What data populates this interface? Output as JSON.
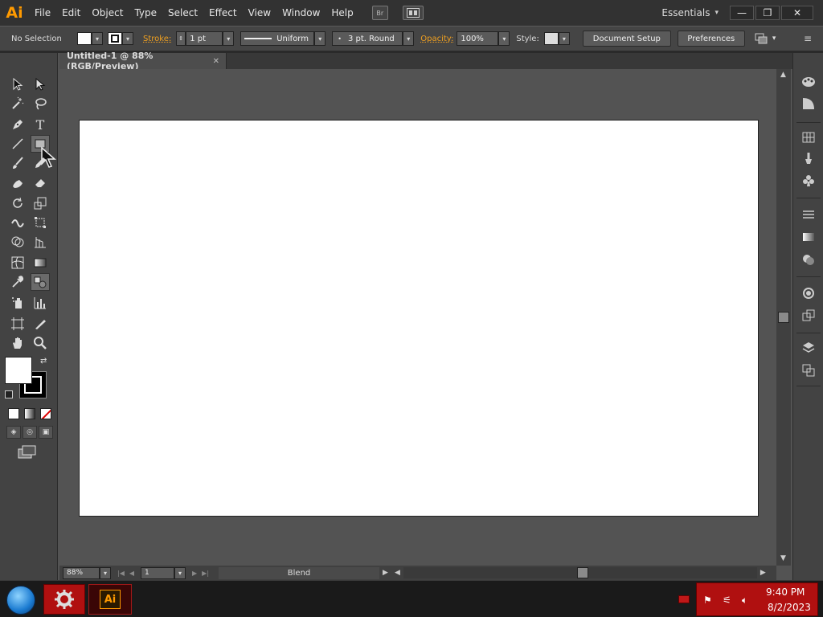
{
  "app": {
    "logo": "Ai",
    "workspace": "Essentials"
  },
  "menu": [
    "File",
    "Edit",
    "Object",
    "Type",
    "Select",
    "Effect",
    "View",
    "Window",
    "Help"
  ],
  "bridge_label": "Br",
  "control": {
    "selection": "No Selection",
    "stroke_label": "Stroke:",
    "stroke_weight": "1 pt",
    "profile": "Uniform",
    "brush": "3 pt. Round",
    "opacity_label": "Opacity:",
    "opacity": "100%",
    "style_label": "Style:",
    "document_setup": "Document Setup",
    "preferences": "Preferences"
  },
  "document": {
    "tab_title": "Untitled-1 @ 88% (RGB/Preview)"
  },
  "status": {
    "zoom": "88%",
    "artboard": "1",
    "info": "Blend"
  },
  "taskbar": {
    "app_label": "Ai",
    "time": "9:40 PM",
    "date": "8/2/2023"
  },
  "colors": {
    "accent": "#ff9a00",
    "chrome_dark": "#323232",
    "panel": "#434343",
    "pasteboard": "#535353",
    "tray": "#b01010"
  }
}
